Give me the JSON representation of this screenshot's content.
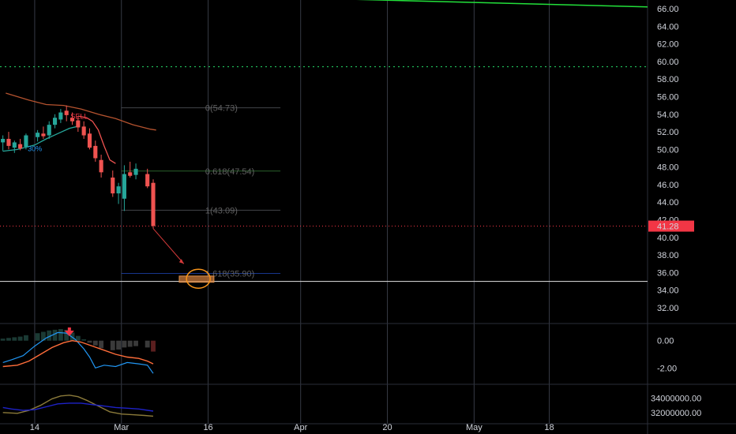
{
  "chart_data": [
    {
      "type": "candlestick",
      "panel": "price",
      "yticks": [
        "66.00",
        "64.00",
        "62.00",
        "60.00",
        "58.00",
        "56.00",
        "54.00",
        "52.00",
        "50.00",
        "48.00",
        "46.00",
        "44.00",
        "42.00",
        "40.00",
        "38.00",
        "36.00",
        "34.00",
        "32.00"
      ],
      "ylim": [
        30.2,
        67.2
      ],
      "xticks": [
        {
          "label": "14",
          "day": 14
        },
        {
          "label": "Mar",
          "day": 29
        },
        {
          "label": "16",
          "day": 44
        },
        {
          "label": "Apr",
          "day": 60
        },
        {
          "label": "20",
          "day": 75
        },
        {
          "label": "May",
          "day": 90
        },
        {
          "label": "18",
          "day": 103
        }
      ],
      "xlim": [
        8,
        120
      ],
      "last_price": {
        "label": "41.28",
        "value": 41.28,
        "color": "#f23645"
      },
      "green_dotted_level": 59.4,
      "support_level": 35.0,
      "candles": [
        {
          "d": 8.5,
          "o": 50.8,
          "h": 51.6,
          "l": 49.8,
          "c": 51.2
        },
        {
          "d": 9.5,
          "o": 51.2,
          "h": 52.0,
          "l": 50.0,
          "c": 50.4
        },
        {
          "d": 10.5,
          "o": 50.2,
          "h": 51.0,
          "l": 49.6,
          "c": 50.8
        },
        {
          "d": 11.5,
          "o": 50.6,
          "h": 51.2,
          "l": 49.9,
          "c": 50.1
        },
        {
          "d": 12.5,
          "o": 50.3,
          "h": 51.8,
          "l": 50.0,
          "c": 51.6
        },
        {
          "d": 14.5,
          "o": 51.4,
          "h": 52.2,
          "l": 50.9,
          "c": 51.9
        },
        {
          "d": 15.5,
          "o": 51.8,
          "h": 52.6,
          "l": 51.2,
          "c": 51.5
        },
        {
          "d": 16.5,
          "o": 51.6,
          "h": 53.2,
          "l": 51.2,
          "c": 52.8
        },
        {
          "d": 17.5,
          "o": 52.8,
          "h": 54.0,
          "l": 52.4,
          "c": 53.6
        },
        {
          "d": 18.5,
          "o": 53.4,
          "h": 54.6,
          "l": 53.0,
          "c": 54.2
        },
        {
          "d": 19.5,
          "o": 54.4,
          "h": 55.0,
          "l": 53.2,
          "c": 53.9
        },
        {
          "d": 20.5,
          "o": 53.6,
          "h": 54.2,
          "l": 52.8,
          "c": 53.2
        },
        {
          "d": 21.5,
          "o": 53.3,
          "h": 53.8,
          "l": 52.0,
          "c": 52.5
        },
        {
          "d": 22.5,
          "o": 52.6,
          "h": 53.2,
          "l": 51.2,
          "c": 51.6
        },
        {
          "d": 23.5,
          "o": 51.8,
          "h": 52.4,
          "l": 50.0,
          "c": 50.2
        },
        {
          "d": 24.5,
          "o": 50.4,
          "h": 51.0,
          "l": 48.6,
          "c": 49.0
        },
        {
          "d": 25.5,
          "o": 48.8,
          "h": 49.4,
          "l": 46.8,
          "c": 47.4
        },
        {
          "d": 27.5,
          "o": 46.8,
          "h": 47.6,
          "l": 44.6,
          "c": 45.0
        },
        {
          "d": 28.5,
          "o": 45.0,
          "h": 46.2,
          "l": 43.8,
          "c": 45.8
        },
        {
          "d": 29.5,
          "o": 44.4,
          "h": 48.2,
          "l": 43.0,
          "c": 47.2
        },
        {
          "d": 30.5,
          "o": 47.4,
          "h": 48.6,
          "l": 46.8,
          "c": 47.0
        },
        {
          "d": 31.5,
          "o": 47.1,
          "h": 48.4,
          "l": 46.6,
          "c": 47.8
        },
        {
          "d": 33.5,
          "o": 47.2,
          "h": 47.8,
          "l": 45.6,
          "c": 45.8
        },
        {
          "d": 34.5,
          "o": 46.2,
          "h": 46.6,
          "l": 41.0,
          "c": 41.3
        }
      ],
      "ma_red": [
        [
          9,
          56.4
        ],
        [
          13,
          55.6
        ],
        [
          16,
          55.1
        ],
        [
          19,
          55.0
        ],
        [
          22,
          54.6
        ],
        [
          25,
          54.0
        ],
        [
          28,
          53.5
        ],
        [
          31,
          52.8
        ],
        [
          34,
          52.3
        ],
        [
          35,
          52.2
        ]
      ],
      "supertrend_green": [
        [
          8.5,
          49.8
        ],
        [
          11,
          50.0
        ],
        [
          14,
          50.5
        ],
        [
          16,
          51.2
        ],
        [
          18,
          51.8
        ],
        [
          20,
          52.4
        ],
        [
          21.3,
          52.6
        ]
      ],
      "supertrend_red": [
        [
          21.5,
          53.8
        ],
        [
          23,
          53.6
        ],
        [
          24,
          53.2
        ],
        [
          25,
          52.2
        ],
        [
          26,
          50.4
        ],
        [
          27,
          48.8
        ],
        [
          28,
          48.4
        ]
      ],
      "signals": [
        {
          "text": "SELL",
          "d": 20.2,
          "y": 53.5,
          "color": "#f23645"
        },
        {
          "text": "30%",
          "d": 12.8,
          "y": 49.8,
          "color": "#2196f3"
        }
      ],
      "fibonacci": [
        {
          "label": "0(54.73)",
          "value": 54.73,
          "color": "#787b86"
        },
        {
          "label": "0.618(47.54)",
          "value": 47.54,
          "color": "#4caf50"
        },
        {
          "label": "1(43.09)",
          "value": 43.09,
          "color": "#787b86"
        },
        {
          "label": "1.618(35.90)",
          "value": 35.9,
          "color": "#2962ff"
        }
      ],
      "projection_arrow": {
        "from": [
          34.5,
          41.0
        ],
        "to": [
          39.8,
          37.0
        ]
      },
      "target_zone": {
        "d0": 39.0,
        "d1": 45.0,
        "y0": 34.9,
        "y1": 35.6
      },
      "target_circle": {
        "d": 42.3,
        "y": 35.3
      },
      "trend_line_green": {
        "from": [
          61.0,
          67.2
        ],
        "to": [
          120,
          66.2
        ]
      }
    },
    {
      "type": "macd",
      "panel": "macd",
      "yticks": [
        "0.00",
        "-2.00"
      ],
      "ylim": [
        -3.2,
        1.2
      ],
      "histogram": [
        {
          "d": 8.5,
          "v": 0.15
        },
        {
          "d": 9.5,
          "v": 0.2
        },
        {
          "d": 10.5,
          "v": 0.25
        },
        {
          "d": 11.5,
          "v": 0.3
        },
        {
          "d": 12.5,
          "v": 0.4
        },
        {
          "d": 14.5,
          "v": 0.55
        },
        {
          "d": 15.5,
          "v": 0.65
        },
        {
          "d": 16.5,
          "v": 0.75
        },
        {
          "d": 17.5,
          "v": 0.8
        },
        {
          "d": 18.5,
          "v": 0.85
        },
        {
          "d": 19.5,
          "v": 0.8
        },
        {
          "d": 20.5,
          "v": 0.6
        },
        {
          "d": 21.5,
          "v": 0.35
        },
        {
          "d": 22.5,
          "v": 0.1
        },
        {
          "d": 23.5,
          "v": -0.15
        },
        {
          "d": 24.5,
          "v": -0.35
        },
        {
          "d": 25.5,
          "v": -0.55
        },
        {
          "d": 27.5,
          "v": -0.7
        },
        {
          "d": 28.5,
          "v": -0.65
        },
        {
          "d": 29.5,
          "v": -0.5
        },
        {
          "d": 30.5,
          "v": -0.45
        },
        {
          "d": 31.5,
          "v": -0.4
        },
        {
          "d": 33.5,
          "v": -0.5
        },
        {
          "d": 34.5,
          "v": -0.8
        }
      ],
      "macd_line": [
        [
          8.5,
          -1.6
        ],
        [
          10,
          -1.4
        ],
        [
          12,
          -1.1
        ],
        [
          14,
          -0.4
        ],
        [
          16,
          0.2
        ],
        [
          18,
          0.6
        ],
        [
          19.5,
          0.55
        ],
        [
          21,
          0.1
        ],
        [
          22.5,
          -0.6
        ],
        [
          23.5,
          -1.2
        ],
        [
          24.5,
          -2.0
        ],
        [
          26,
          -1.8
        ],
        [
          28,
          -1.9
        ],
        [
          30,
          -1.6
        ],
        [
          32,
          -1.7
        ],
        [
          33.5,
          -1.8
        ],
        [
          34.5,
          -2.4
        ]
      ],
      "signal_line": [
        [
          8.5,
          -1.9
        ],
        [
          11,
          -1.8
        ],
        [
          13,
          -1.5
        ],
        [
          15,
          -1.0
        ],
        [
          17,
          -0.5
        ],
        [
          19,
          -0.15
        ],
        [
          20.5,
          0.0
        ],
        [
          22,
          -0.1
        ],
        [
          24,
          -0.4
        ],
        [
          26,
          -0.7
        ],
        [
          28,
          -1.0
        ],
        [
          30,
          -1.2
        ],
        [
          32,
          -1.3
        ],
        [
          33.5,
          -1.5
        ],
        [
          34.5,
          -1.7
        ]
      ],
      "cross_arrow": {
        "d": 20.0,
        "y": 0.45,
        "color": "#f23645"
      }
    },
    {
      "type": "line",
      "panel": "volume-oscillator",
      "yticks": [
        "34000000.00",
        "32000000.00"
      ],
      "ylim": [
        31000000,
        35800000
      ],
      "series": [
        {
          "color": "#8b7a3a",
          "points": [
            [
              8.5,
              32000000
            ],
            [
              11,
              31900000
            ],
            [
              13,
              32300000
            ],
            [
              15,
              33000000
            ],
            [
              17,
              33900000
            ],
            [
              18.5,
              34300000
            ],
            [
              20,
              34400000
            ],
            [
              21.5,
              34200000
            ],
            [
              23,
              33700000
            ],
            [
              25,
              32900000
            ],
            [
              27,
              32100000
            ],
            [
              29,
              31800000
            ],
            [
              31,
              31700000
            ],
            [
              33,
              31600000
            ],
            [
              34.5,
              31500000
            ]
          ]
        },
        {
          "color": "#1e22c8",
          "points": [
            [
              8.5,
              32700000
            ],
            [
              10,
              32500000
            ],
            [
              12,
              32300000
            ],
            [
              14,
              32400000
            ],
            [
              16,
              32800000
            ],
            [
              18,
              33200000
            ],
            [
              20,
              33300000
            ],
            [
              22,
              33300000
            ],
            [
              24,
              33100000
            ],
            [
              26,
              32900000
            ],
            [
              28,
              32700000
            ],
            [
              30,
              32600000
            ],
            [
              32,
              32500000
            ],
            [
              34.5,
              32200000
            ]
          ]
        }
      ]
    }
  ],
  "colors": {
    "up": "#26a69a",
    "down": "#ef5350",
    "grid": "#363a45",
    "text": "#d1d4dc",
    "zone_fill": "#c8783a",
    "circle": "#f7931a"
  }
}
